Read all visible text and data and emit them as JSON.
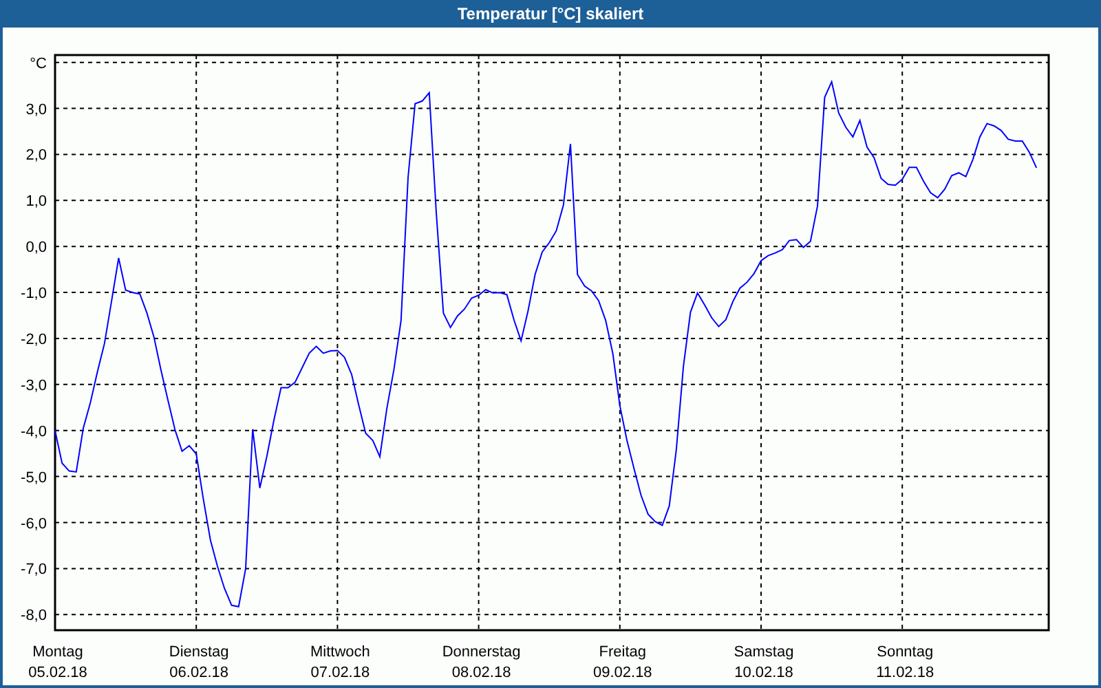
{
  "window": {
    "title": "Temperatur [°C] skaliert"
  },
  "chart": {
    "chart_data": {
      "type": "line",
      "grid": true,
      "ylim": [
        -8.34,
        4.16
      ],
      "yticks": [
        {
          "value": 4,
          "label": "°C"
        },
        {
          "value": 3,
          "label": "3,0"
        },
        {
          "value": 2,
          "label": "2,0"
        },
        {
          "value": 1,
          "label": "1,0"
        },
        {
          "value": 0,
          "label": "0,0"
        },
        {
          "value": -1,
          "label": "-1,0"
        },
        {
          "value": -2,
          "label": "-2,0"
        },
        {
          "value": -3,
          "label": "-3,0"
        },
        {
          "value": -4,
          "label": "-4,0"
        },
        {
          "value": -5,
          "label": "-5,0"
        },
        {
          "value": -6,
          "label": "-6,0"
        },
        {
          "value": -7,
          "label": "-7,0"
        },
        {
          "value": -8,
          "label": "-8,0"
        }
      ],
      "categories": [
        "Montag\n05.02.18",
        null,
        null,
        null,
        null,
        null,
        null,
        null,
        null,
        null,
        null,
        null,
        null,
        null,
        null,
        null,
        null,
        null,
        null,
        null,
        "Dienstag\n06.02.18",
        null,
        null,
        null,
        null,
        null,
        null,
        null,
        null,
        null,
        null,
        null,
        null,
        null,
        null,
        null,
        null,
        null,
        null,
        null,
        "Mittwoch\n07.02.18",
        null,
        null,
        null,
        null,
        null,
        null,
        null,
        null,
        null,
        null,
        null,
        null,
        null,
        null,
        null,
        null,
        null,
        null,
        null,
        "Donnerstag\n08.02.18",
        null,
        null,
        null,
        null,
        null,
        null,
        null,
        null,
        null,
        null,
        null,
        null,
        null,
        null,
        null,
        null,
        null,
        null,
        null,
        "Freitag\n09.02.18",
        null,
        null,
        null,
        null,
        null,
        null,
        null,
        null,
        null,
        null,
        null,
        null,
        null,
        null,
        null,
        null,
        null,
        null,
        null,
        "Samstag\n10.02.18",
        null,
        null,
        null,
        null,
        null,
        null,
        null,
        null,
        null,
        null,
        null,
        null,
        null,
        null,
        null,
        null,
        null,
        null,
        null,
        "Sonntag\n11.02.18",
        null,
        null,
        null,
        null,
        null,
        null,
        null,
        null,
        null,
        null,
        null,
        null,
        null,
        null,
        null,
        null,
        null,
        null,
        null
      ],
      "series": [
        {
          "color": "#0000ff",
          "values": [
            -4,
            -4.71,
            -4.88,
            -4.9,
            -3.95,
            -3.39,
            -2.72,
            -2.11,
            -1.2,
            -0.25,
            -0.95,
            -1,
            -1.03,
            -1.44,
            -1.96,
            -2.69,
            -3.35,
            -3.99,
            -4.45,
            -4.33,
            -4.51,
            -5.48,
            -6.38,
            -6.95,
            -7.43,
            -7.8,
            -7.83,
            -7,
            -3.97,
            -5.25,
            -4.56,
            -3.78,
            -3.07,
            -3.07,
            -2.95,
            -2.63,
            -2.32,
            -2.17,
            -2.32,
            -2.27,
            -2.26,
            -2.41,
            -2.78,
            -3.44,
            -4.06,
            -4.22,
            -4.57,
            -3.52,
            -2.68,
            -1.61,
            1.5,
            3.1,
            3.16,
            3.34,
            0.73,
            -1.45,
            -1.76,
            -1.51,
            -1.36,
            -1.12,
            -1.06,
            -0.94,
            -1.01,
            -1,
            -1.05,
            -1.6,
            -2.05,
            -1.4,
            -0.61,
            -0.12,
            0.08,
            0.34,
            0.9,
            2.23,
            -0.61,
            -0.86,
            -0.97,
            -1.18,
            -1.61,
            -2.33,
            -3.46,
            -4.21,
            -4.83,
            -5.41,
            -5.82,
            -5.98,
            -6.06,
            -5.64,
            -4.42,
            -2.6,
            -1.43,
            -1.01,
            -1.27,
            -1.55,
            -1.74,
            -1.59,
            -1.2,
            -0.91,
            -0.78,
            -0.59,
            -0.31,
            -0.2,
            -0.14,
            -0.07,
            0.13,
            0.15,
            -0.02,
            0.11,
            0.88,
            3.24,
            3.58,
            2.9,
            2.59,
            2.38,
            2.74,
            2.16,
            1.93,
            1.48,
            1.35,
            1.33,
            1.46,
            1.72,
            1.72,
            1.42,
            1.17,
            1.06,
            1.24,
            1.54,
            1.6,
            1.52,
            1.89,
            2.38,
            2.67,
            2.62,
            2.52,
            2.33,
            2.29,
            2.29,
            2.05,
            1.71
          ]
        }
      ]
    }
  }
}
